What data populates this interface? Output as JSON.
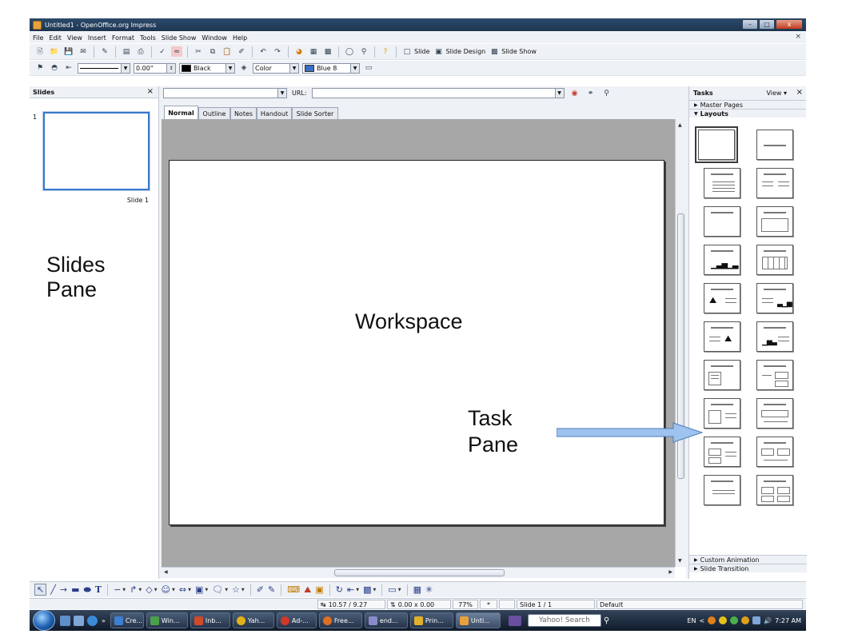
{
  "window": {
    "title": "Untitled1 - OpenOffice.org Impress",
    "minimize": "–",
    "maximize": "□",
    "close": "x"
  },
  "menu": {
    "items": [
      "File",
      "Edit",
      "View",
      "Insert",
      "Format",
      "Tools",
      "Slide Show",
      "Window",
      "Help"
    ],
    "close": "×"
  },
  "toolbar1": {
    "slide": "Slide",
    "slide_design": "Slide Design",
    "slide_show": "Slide Show"
  },
  "toolbar2": {
    "line_width": "0.00\"",
    "line_color": "Black",
    "area_style": "Color",
    "area_fill": "Blue 8",
    "line_color_hex": "#000000",
    "area_fill_hex": "#3a6ec8"
  },
  "slides_pane": {
    "title": "Slides",
    "close": "×",
    "slide_number": "1",
    "slide_label": "Slide 1"
  },
  "url_bar": {
    "label": "URL:"
  },
  "view_tabs": [
    "Normal",
    "Outline",
    "Notes",
    "Handout",
    "Slide Sorter"
  ],
  "annotations": {
    "slides_pane_line1": "Slides",
    "slides_pane_line2": "Pane",
    "workspace": "Workspace",
    "task_pane_line1": "Task",
    "task_pane_line2": "Pane",
    "arrow_color": "#9ec3ee"
  },
  "task_pane": {
    "title": "Tasks",
    "view": "View",
    "close": "×",
    "sections": {
      "master_pages": "Master Pages",
      "layouts": "Layouts",
      "custom_animation": "Custom Animation",
      "slide_transition": "Slide Transition"
    }
  },
  "status_bar": {
    "position": "10.57 / 9.27",
    "size": "0.00 x 0.00",
    "zoom": "77%",
    "modified": "*",
    "slide": "Slide 1 / 1",
    "master": "Default"
  },
  "taskbar": {
    "buttons": [
      "Cre...",
      "Win...",
      "Inb...",
      "Yah...",
      "Ad-...",
      "Free...",
      "end...",
      "Prin...",
      "Unti..."
    ],
    "search": "Yahoo! Search",
    "language": "EN",
    "clock": "7:27 AM"
  }
}
